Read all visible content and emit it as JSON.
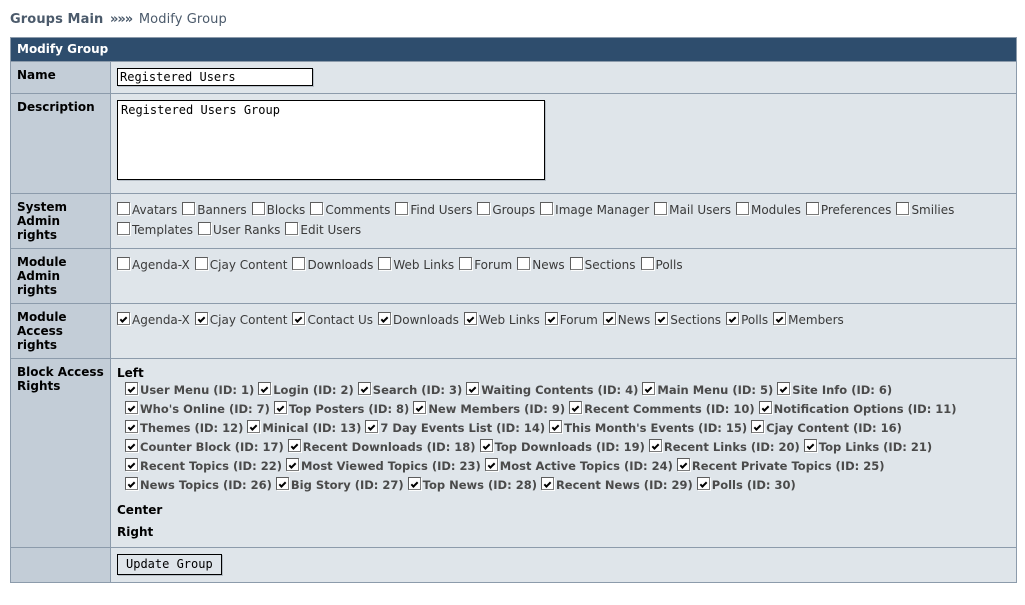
{
  "breadcrumb": {
    "root": "Groups Main",
    "separator": "»»»",
    "current": "Modify Group"
  },
  "panel": {
    "title": "Modify Group"
  },
  "fields": {
    "name": {
      "label": "Name",
      "value": "Registered Users",
      "placeholder": ""
    },
    "description": {
      "label": "Description",
      "value": "Registered Users Group",
      "placeholder": ""
    },
    "system_admin_rights": {
      "label": "System Admin rights"
    },
    "module_admin_rights": {
      "label": "Module Admin rights"
    },
    "module_access_rights": {
      "label": "Module Access rights"
    },
    "block_access_rights": {
      "label": "Block Access Rights"
    }
  },
  "system_admin_rights": [
    {
      "label": "Avatars",
      "checked": false
    },
    {
      "label": "Banners",
      "checked": false
    },
    {
      "label": "Blocks",
      "checked": false
    },
    {
      "label": "Comments",
      "checked": false
    },
    {
      "label": "Find Users",
      "checked": false
    },
    {
      "label": "Groups",
      "checked": false
    },
    {
      "label": "Image Manager",
      "checked": false
    },
    {
      "label": "Mail Users",
      "checked": false
    },
    {
      "label": "Modules",
      "checked": false
    },
    {
      "label": "Preferences",
      "checked": false
    },
    {
      "label": "Smilies",
      "checked": false
    },
    {
      "label": "Templates",
      "checked": false
    },
    {
      "label": "User Ranks",
      "checked": false
    },
    {
      "label": "Edit Users",
      "checked": false
    }
  ],
  "module_admin_rights": [
    {
      "label": "Agenda-X",
      "checked": false
    },
    {
      "label": "Cjay Content",
      "checked": false
    },
    {
      "label": "Downloads",
      "checked": false
    },
    {
      "label": "Web Links",
      "checked": false
    },
    {
      "label": "Forum",
      "checked": false
    },
    {
      "label": "News",
      "checked": false
    },
    {
      "label": "Sections",
      "checked": false
    },
    {
      "label": "Polls",
      "checked": false
    }
  ],
  "module_access_rights": [
    {
      "label": "Agenda-X",
      "checked": true
    },
    {
      "label": "Cjay Content",
      "checked": true
    },
    {
      "label": "Contact Us",
      "checked": true
    },
    {
      "label": "Downloads",
      "checked": true
    },
    {
      "label": "Web Links",
      "checked": true
    },
    {
      "label": "Forum",
      "checked": true
    },
    {
      "label": "News",
      "checked": true
    },
    {
      "label": "Sections",
      "checked": true
    },
    {
      "label": "Polls",
      "checked": true
    },
    {
      "label": "Members",
      "checked": true
    }
  ],
  "block_zones": [
    {
      "heading": "Left",
      "blocks": [
        {
          "label": "User Menu (ID: 1)",
          "checked": true
        },
        {
          "label": "Login (ID: 2)",
          "checked": true
        },
        {
          "label": "Search (ID: 3)",
          "checked": true
        },
        {
          "label": "Waiting Contents (ID: 4)",
          "checked": true
        },
        {
          "label": "Main Menu (ID: 5)",
          "checked": true
        },
        {
          "label": "Site Info (ID: 6)",
          "checked": true
        },
        {
          "label": "Who's Online (ID: 7)",
          "checked": true
        },
        {
          "label": "Top Posters (ID: 8)",
          "checked": true
        },
        {
          "label": "New Members (ID: 9)",
          "checked": true
        },
        {
          "label": "Recent Comments (ID: 10)",
          "checked": true
        },
        {
          "label": "Notification Options (ID: 11)",
          "checked": true
        },
        {
          "label": "Themes (ID: 12)",
          "checked": true
        },
        {
          "label": "Minical (ID: 13)",
          "checked": true
        },
        {
          "label": "7 Day Events List (ID: 14)",
          "checked": true
        },
        {
          "label": "This Month's Events (ID: 15)",
          "checked": true
        },
        {
          "label": "Cjay Content (ID: 16)",
          "checked": true
        },
        {
          "label": "Counter Block (ID: 17)",
          "checked": true
        },
        {
          "label": "Recent Downloads (ID: 18)",
          "checked": true
        },
        {
          "label": "Top Downloads (ID: 19)",
          "checked": true
        },
        {
          "label": "Recent Links (ID: 20)",
          "checked": true
        },
        {
          "label": "Top Links (ID: 21)",
          "checked": true
        },
        {
          "label": "Recent Topics (ID: 22)",
          "checked": true
        },
        {
          "label": "Most Viewed Topics (ID: 23)",
          "checked": true
        },
        {
          "label": "Most Active Topics (ID: 24)",
          "checked": true
        },
        {
          "label": "Recent Private Topics (ID: 25)",
          "checked": true
        },
        {
          "label": "News Topics (ID: 26)",
          "checked": true
        },
        {
          "label": "Big Story (ID: 27)",
          "checked": true
        },
        {
          "label": "Top News (ID: 28)",
          "checked": true
        },
        {
          "label": "Recent News (ID: 29)",
          "checked": true
        },
        {
          "label": "Polls (ID: 30)",
          "checked": true
        }
      ]
    },
    {
      "heading": "Center",
      "blocks": []
    },
    {
      "heading": "Right",
      "blocks": []
    }
  ],
  "actions": {
    "update_label": "Update Group"
  },
  "colors": {
    "titlebar_bg": "#2e4d6d",
    "label_bg": "#c3cdd7",
    "field_bg": "#dfe5ea",
    "border": "#8c9bab",
    "breadcrumb_text": "#4b5a6b"
  }
}
